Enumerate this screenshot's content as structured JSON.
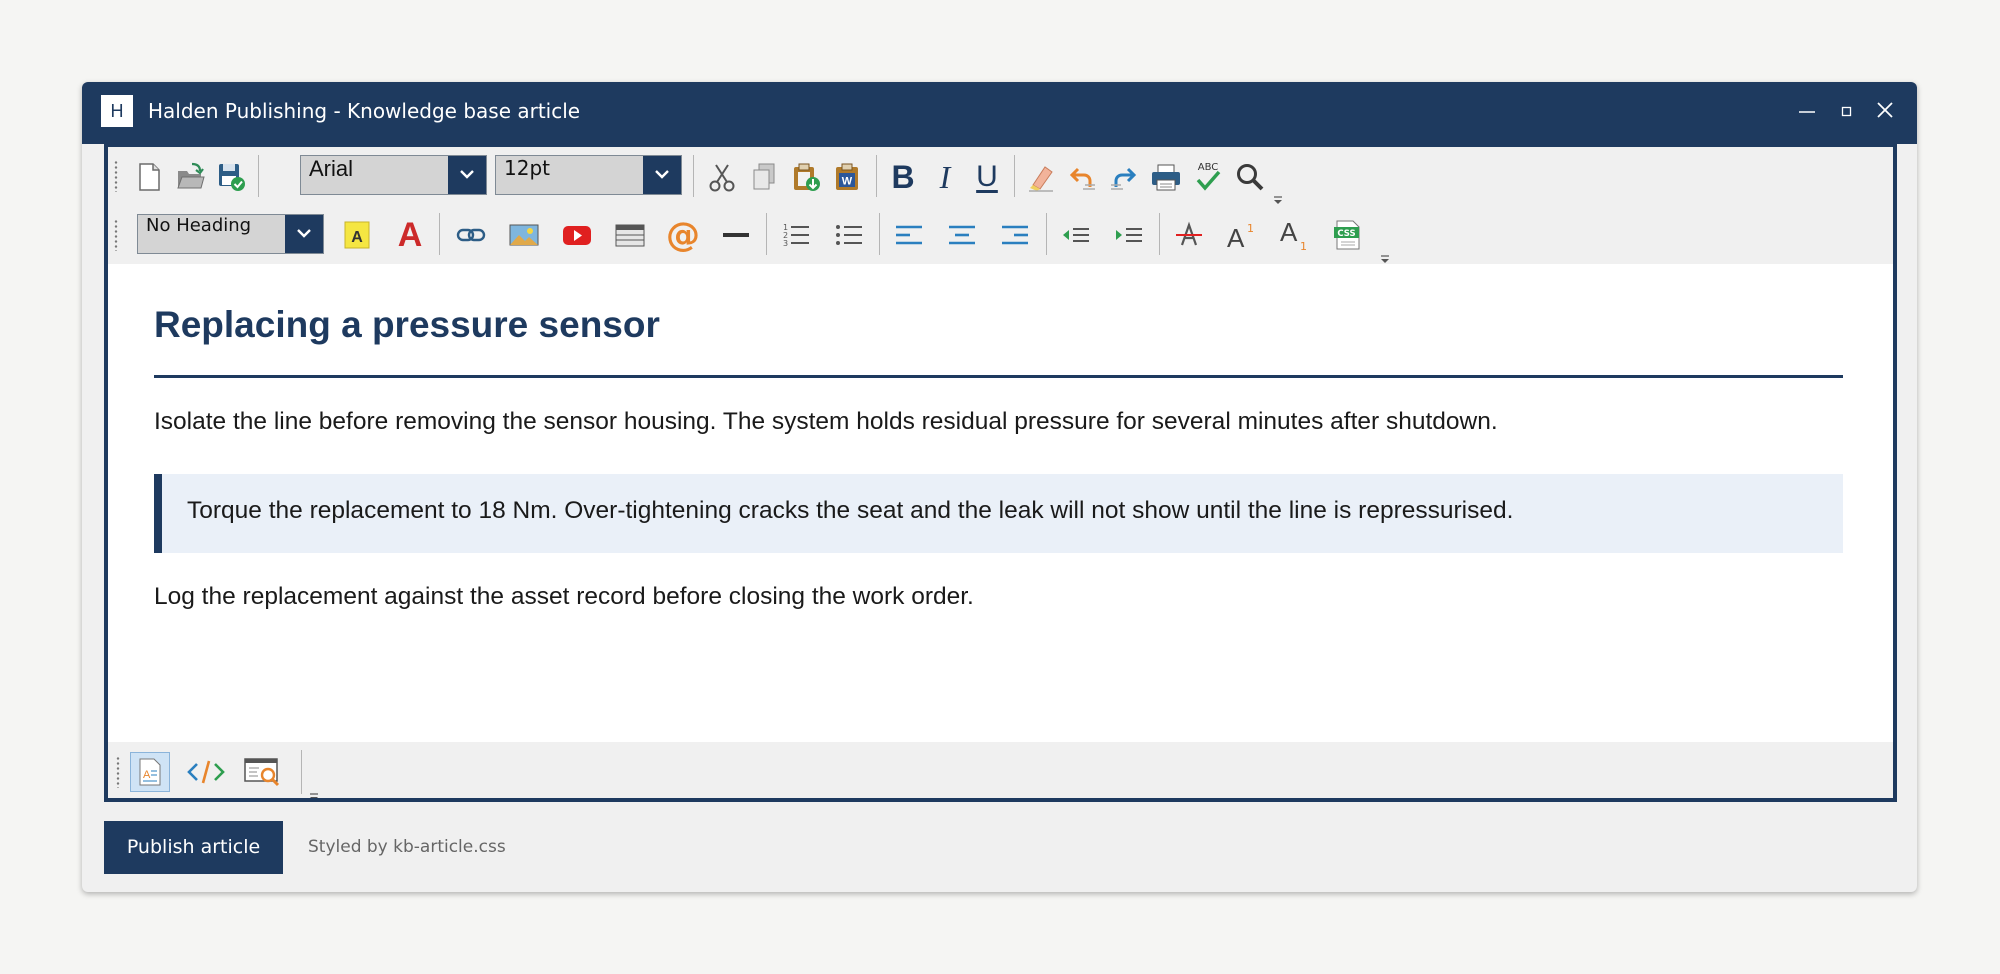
{
  "window": {
    "app_icon_letter": "H",
    "title": "Halden Publishing - Knowledge base article",
    "accent_color": "#1e3a5f"
  },
  "toolbar_row1": {
    "font_family": "Arial",
    "font_size": "12pt",
    "icons": [
      "new-document-icon",
      "open-folder-icon",
      "save-icon",
      "cut-icon",
      "copy-icon",
      "paste-icon",
      "paste-from-word-icon",
      "bold-icon",
      "italic-icon",
      "underline-icon",
      "clear-formatting-icon",
      "undo-icon",
      "redo-icon",
      "print-icon",
      "spellcheck-icon",
      "find-icon",
      "toolbar-overflow-icon"
    ],
    "bold_label": "B",
    "italic_label": "I",
    "underline_label": "U",
    "spellcheck_label": "ABC",
    "paste_word_label": "W"
  },
  "toolbar_row2": {
    "paragraph_style": "No Heading",
    "highlight_label": "A",
    "font_color_label": "A",
    "at_label": "@",
    "superscript_label": "A",
    "superscript_mark": "1",
    "subscript_label": "A",
    "subscript_mark": "1",
    "css_label": "CSS",
    "icons": [
      "highlight-color-icon",
      "font-color-icon",
      "insert-link-icon",
      "insert-image-icon",
      "insert-video-icon",
      "insert-table-icon",
      "insert-email-icon",
      "horizontal-rule-icon",
      "numbered-list-icon",
      "bulleted-list-icon",
      "align-left-icon",
      "align-center-icon",
      "align-right-icon",
      "outdent-icon",
      "indent-icon",
      "strikethrough-icon",
      "superscript-icon",
      "subscript-icon",
      "css-icon",
      "toolbar-overflow-icon"
    ]
  },
  "article": {
    "heading": "Replacing a pressure sensor",
    "para1": "Isolate the line before removing the sensor housing. The system holds residual pressure for several minutes after shutdown.",
    "callout": "Torque the replacement to 18 Nm. Over-tightening cracks the seat and the leak will not show until the line is repressurised.",
    "para2": "Log the replacement against the asset record before closing the work order."
  },
  "view_modes": {
    "icons": [
      "design-view-icon",
      "html-source-view-icon",
      "preview-view-icon"
    ],
    "active": "design-view-icon"
  },
  "footer": {
    "publish_label": "Publish article",
    "stylesheet_note": "Styled by kb-article.css"
  }
}
